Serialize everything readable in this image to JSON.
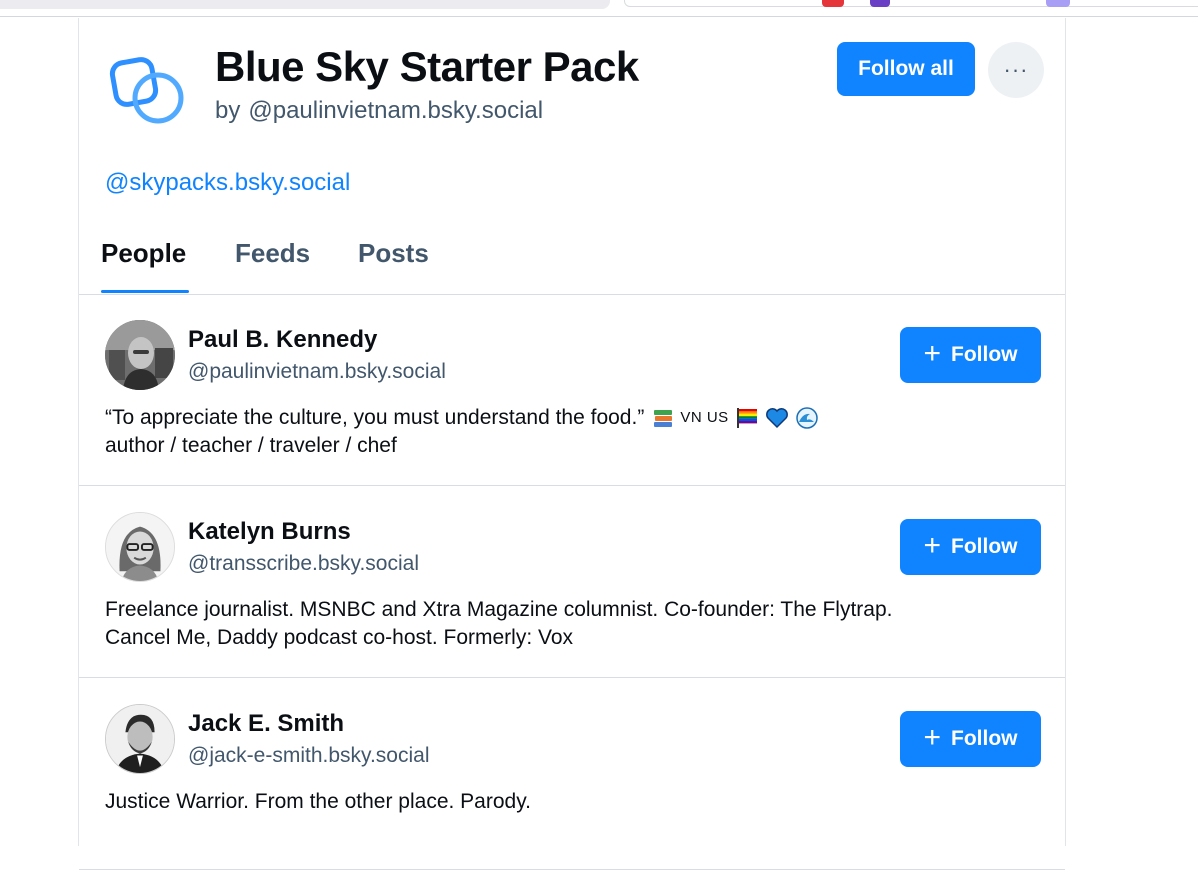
{
  "pack": {
    "title": "Blue Sky Starter Pack",
    "by_prefix": "by",
    "author_handle": "@paulinvietnam.bsky.social",
    "creator_link": "@skypacks.bsky.social",
    "follow_all_label": "Follow all",
    "more_label": "···"
  },
  "tabs": [
    {
      "label": "People",
      "active": true
    },
    {
      "label": "Feeds",
      "active": false
    },
    {
      "label": "Posts",
      "active": false
    }
  ],
  "people": [
    {
      "name": "Paul B. Kennedy",
      "handle": "@paulinvietnam.bsky.social",
      "bio_line1": "“To appreciate the culture, you must understand the food.”",
      "bio_flags": "VN US",
      "bio_line2": "author / teacher / traveler / chef",
      "follow_label": "Follow"
    },
    {
      "name": "Katelyn Burns",
      "handle": "@transscribe.bsky.social",
      "bio_line1": "Freelance journalist. MSNBC and Xtra Magazine columnist. Co-founder: The Flytrap.",
      "bio_line2": "Cancel Me, Daddy podcast co-host. Formerly: Vox",
      "follow_label": "Follow"
    },
    {
      "name": "Jack E. Smith",
      "handle": "@jack-e-smith.bsky.social",
      "bio_line1": "Justice Warrior. From the other place. Parody.",
      "follow_label": "Follow"
    }
  ],
  "colors": {
    "accent": "#1083fe",
    "muted_text": "#42576c",
    "border": "#d9dde2"
  }
}
